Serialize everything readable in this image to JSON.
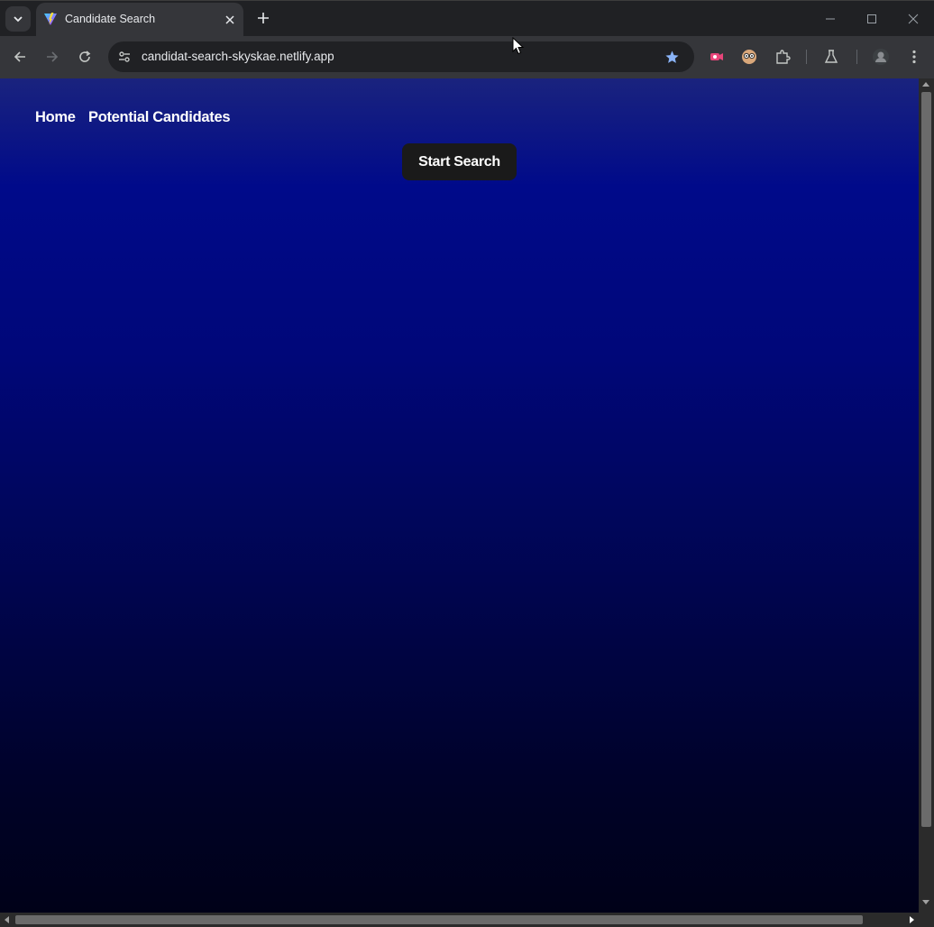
{
  "browser": {
    "tab": {
      "title": "Candidate Search",
      "favicon": "vite-logo-icon"
    },
    "omnibox": {
      "url": "candidat-search-skyskae.netlify.app",
      "bookmarked": true
    },
    "icons": {
      "tab_search": "chevron-down-icon",
      "tab_close": "close-icon",
      "new_tab": "plus-icon",
      "minimize": "minimize-icon",
      "maximize": "maximize-icon",
      "close_window": "close-window-icon",
      "back": "back-arrow-icon",
      "forward": "forward-arrow-icon",
      "reload": "reload-icon",
      "site_info": "tune-icon",
      "bookmark": "star-icon",
      "extension_1": "pink-video-extension-icon",
      "extension_2": "face-extension-icon",
      "extensions": "puzzle-icon",
      "labs": "flask-icon",
      "profile": "avatar-icon",
      "menu": "kebab-menu-icon"
    },
    "colors": {
      "accent_star": "#8ab4f8",
      "chrome_dark": "#202124",
      "toolbar": "#35363a"
    }
  },
  "page": {
    "nav": {
      "home": "Home",
      "potential_candidates": "Potential Candidates"
    },
    "start_button": "Start Search",
    "colors": {
      "gradient_top": "#1a237e",
      "gradient_bottom": "#000118",
      "button_bg": "#1a1a1a",
      "text": "#ffffff"
    }
  }
}
